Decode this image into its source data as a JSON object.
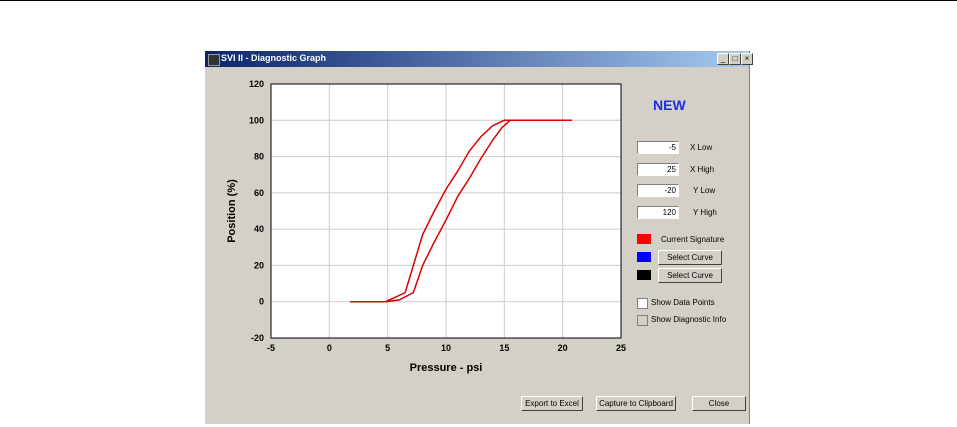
{
  "window": {
    "title": "SVI II  - Diagnostic Graph",
    "controls": [
      "_",
      "□",
      "×"
    ]
  },
  "status_label": "NEW",
  "axis_fields": [
    {
      "value": "-5",
      "label": "X Low"
    },
    {
      "value": "25",
      "label": "X High"
    },
    {
      "value": "-20",
      "label": "Y Low"
    },
    {
      "value": "120",
      "label": "Y High"
    }
  ],
  "legend": [
    {
      "color": "#ff0000",
      "label": "Current Signature",
      "type": "text"
    },
    {
      "color": "#0000ff",
      "label": "Select Curve",
      "type": "button"
    },
    {
      "color": "#000000",
      "label": "Select Curve",
      "type": "button"
    }
  ],
  "options": [
    {
      "label": "Show Data Points",
      "checked": false,
      "enabled": true
    },
    {
      "label": "Show Diagnostic Info",
      "checked": false,
      "enabled": false
    }
  ],
  "buttons": {
    "export": "Export to Excel",
    "capture": "Capture to Clipboard",
    "close": "Close"
  },
  "chart_data": {
    "type": "line",
    "xlabel": "Pressure - psi",
    "ylabel": "Position (%)",
    "xlim": [
      -5,
      25
    ],
    "ylim": [
      -20,
      120
    ],
    "xticks": [
      -5,
      0,
      5,
      10,
      15,
      20,
      25
    ],
    "yticks": [
      -20,
      0,
      20,
      40,
      60,
      80,
      100,
      120
    ],
    "grid": true,
    "series": [
      {
        "color": "#dd0000",
        "x": [
          1.8,
          4.8,
          6.0,
          7.2,
          8.0,
          9.0,
          10.0,
          11.0,
          12.0,
          13.0,
          14.0,
          14.8,
          15.5,
          16.5,
          17.5,
          20.8
        ],
        "y": [
          0,
          0,
          1,
          5,
          20,
          33,
          45,
          58,
          68,
          79,
          89,
          96,
          100,
          100,
          100,
          100
        ]
      },
      {
        "color": "#dd0000",
        "x": [
          20.8,
          17.0,
          15.0,
          14.0,
          13.0,
          12.0,
          11.0,
          10.0,
          9.0,
          8.0,
          7.2,
          6.5,
          5.5,
          4.8,
          1.8
        ],
        "y": [
          100,
          100,
          100,
          97,
          91,
          83,
          72,
          62,
          50,
          37,
          20,
          5,
          2,
          0,
          0
        ]
      }
    ]
  }
}
